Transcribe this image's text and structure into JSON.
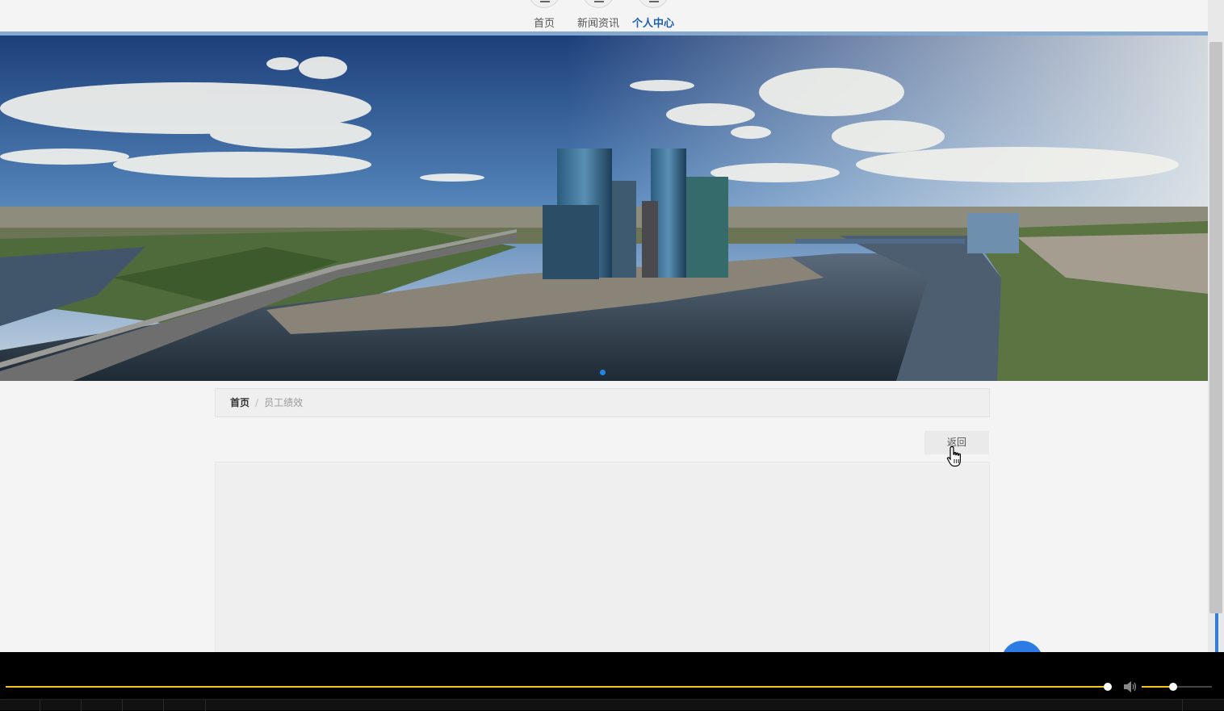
{
  "nav": {
    "items": [
      {
        "label": "首页",
        "active": false,
        "icon": "home-icon"
      },
      {
        "label": "新闻资讯",
        "active": false,
        "icon": "news-icon"
      },
      {
        "label": "个人中心",
        "active": true,
        "icon": "user-icon"
      }
    ]
  },
  "banner": {
    "description_icon": "city-skyline-image",
    "active_slide": 1,
    "slide_count": 1
  },
  "breadcrumb": {
    "home": "首页",
    "separator": "/",
    "current": "员工绩效"
  },
  "actions": {
    "back_label": "返回"
  },
  "player": {
    "progress_fraction": 0.9,
    "volume_fraction": 0.45
  },
  "colors": {
    "accent": "#1f5fa8",
    "nav_line": "#86a9cf",
    "player_progress": "#f0c419",
    "float_button": "#2d7be5"
  }
}
